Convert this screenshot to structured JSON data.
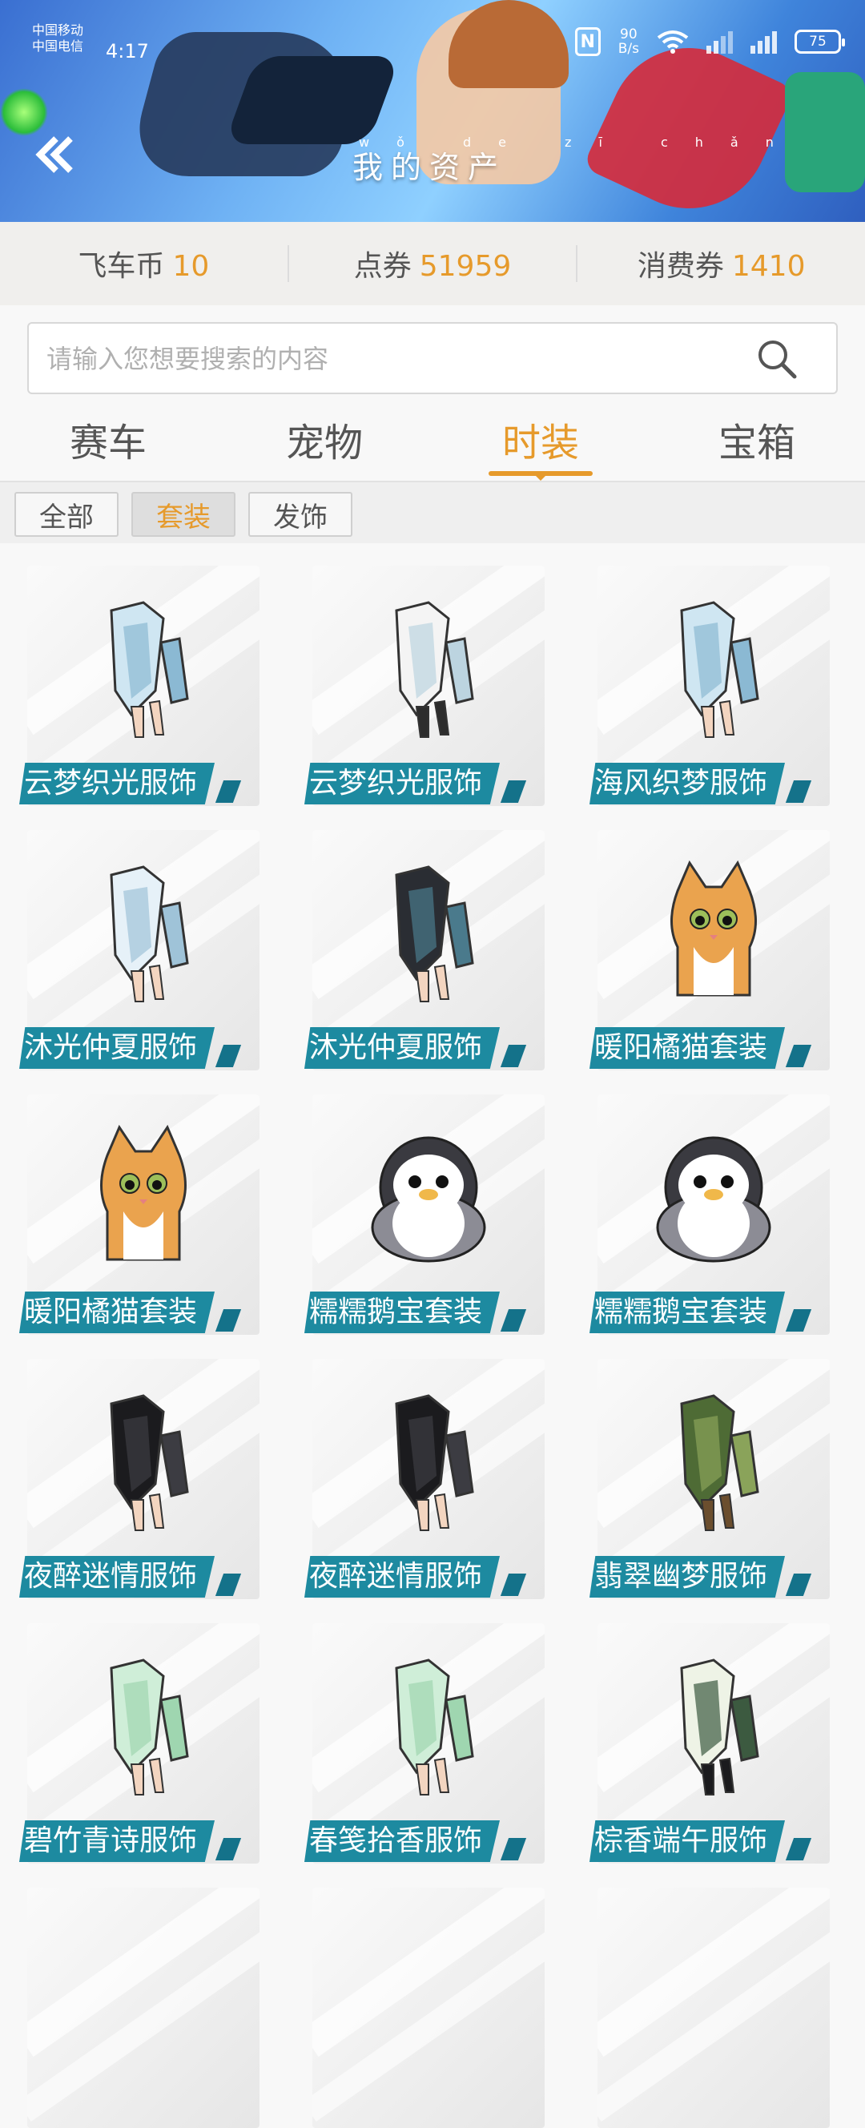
{
  "status": {
    "carrier1": "中国移动",
    "carrier2": "中国电信",
    "time": "4:17",
    "net_speed_value": "90",
    "net_speed_unit": "B/s",
    "battery": "75"
  },
  "header": {
    "title": "我的资产",
    "title_pinyin": "wǒ de zī chǎn"
  },
  "currencies": [
    {
      "label": "飞车币",
      "value": "10"
    },
    {
      "label": "点券",
      "value": "51959"
    },
    {
      "label": "消费券",
      "value": "1410"
    }
  ],
  "search": {
    "placeholder": "请输入您想要搜索的内容"
  },
  "tabs": [
    {
      "label": "赛车"
    },
    {
      "label": "宠物"
    },
    {
      "label": "时装"
    },
    {
      "label": "宝箱"
    }
  ],
  "active_tab": "时装",
  "subtabs": [
    {
      "label": "全部"
    },
    {
      "label": "套装"
    },
    {
      "label": "发饰"
    }
  ],
  "active_subtab": "套装",
  "items": [
    {
      "name": "云梦织光服饰",
      "icon": "outfit-light-blue"
    },
    {
      "name": "云梦织光服饰",
      "icon": "outfit-white"
    },
    {
      "name": "海风织梦服饰",
      "icon": "outfit-light-blue"
    },
    {
      "name": "沐光仲夏服饰",
      "icon": "outfit-white-blue"
    },
    {
      "name": "沐光仲夏服饰",
      "icon": "outfit-dark"
    },
    {
      "name": "暖阳橘猫套装",
      "icon": "cat-orange"
    },
    {
      "name": "暖阳橘猫套装",
      "icon": "cat-orange"
    },
    {
      "name": "糯糯鹅宝套装",
      "icon": "penguin"
    },
    {
      "name": "糯糯鹅宝套装",
      "icon": "penguin"
    },
    {
      "name": "夜醉迷情服饰",
      "icon": "outfit-black"
    },
    {
      "name": "夜醉迷情服饰",
      "icon": "outfit-black"
    },
    {
      "name": "翡翠幽梦服饰",
      "icon": "outfit-green-dark"
    },
    {
      "name": "碧竹青诗服饰",
      "icon": "outfit-mint"
    },
    {
      "name": "春笺拾香服饰",
      "icon": "outfit-mint"
    },
    {
      "name": "棕香端午服饰",
      "icon": "outfit-green-white"
    }
  ],
  "colors": {
    "accent": "#e69a2b",
    "label_bg": "#1d8aa0"
  }
}
